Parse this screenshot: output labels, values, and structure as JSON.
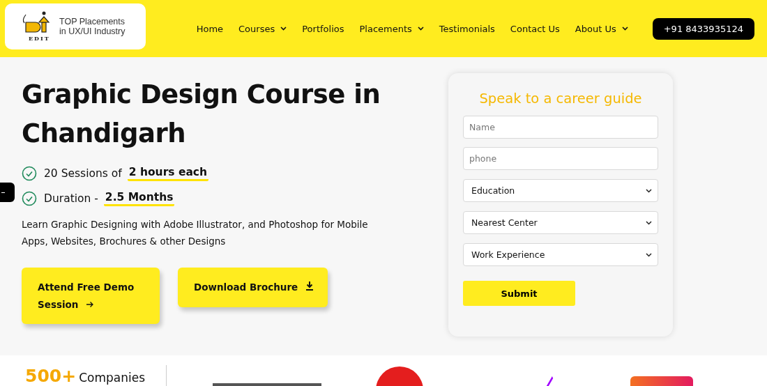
{
  "header": {
    "logo_text": "EDIT",
    "tagline_lines": [
      "TOP Placements",
      "in UX/UI Industry"
    ],
    "nav": [
      {
        "label": "Home",
        "has_menu": false
      },
      {
        "label": "Courses",
        "has_menu": true
      },
      {
        "label": "Portfolios",
        "has_menu": false
      },
      {
        "label": "Placements",
        "has_menu": true
      },
      {
        "label": "Testimonials",
        "has_menu": false
      },
      {
        "label": "Contact Us",
        "has_menu": false
      },
      {
        "label": "About Us",
        "has_menu": true
      }
    ],
    "phone_button": "+91 8433935124"
  },
  "hero": {
    "title": "Graphic Design Course in Chandigarh",
    "features": [
      {
        "text": "20 Sessions of",
        "highlight": "2 hours each"
      },
      {
        "text": "Duration -",
        "highlight": "2.5 Months"
      }
    ],
    "description": "Learn Graphic Designing with Adobe Illustrator, and Photoshop for Mobile Apps, Websites, Brochures & other Designs",
    "buttons": [
      {
        "label": "Attend Free Demo Session",
        "kind": "arrow"
      },
      {
        "label": "Download Brochure",
        "kind": "download"
      }
    ]
  },
  "form": {
    "title": "Speak to a career guide",
    "fields": [
      {
        "kind": "input",
        "placeholder": "Name"
      },
      {
        "kind": "input",
        "placeholder": "phone"
      },
      {
        "kind": "select",
        "value": "Education"
      },
      {
        "kind": "select",
        "value": "Nearest Center"
      },
      {
        "kind": "select",
        "value": "Work Experience"
      }
    ],
    "submit": "Submit"
  },
  "companies": {
    "count": "500+",
    "label": "Companies"
  }
}
